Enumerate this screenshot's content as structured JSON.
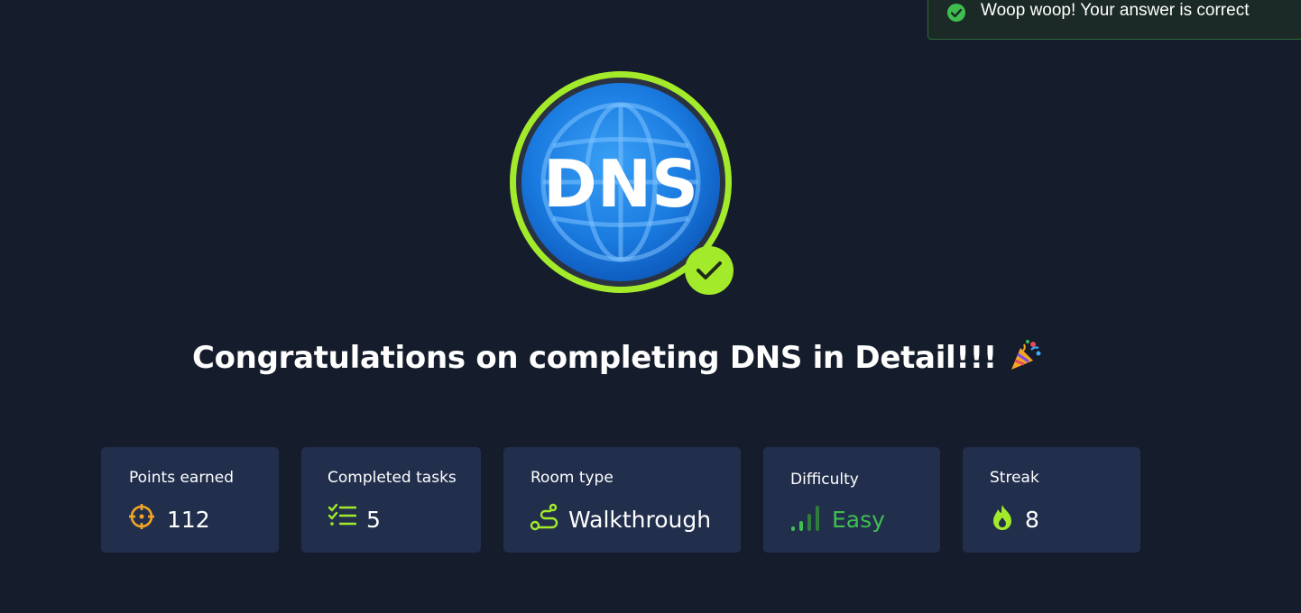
{
  "toast": {
    "message": "Woop woop! Your answer is correct",
    "icon": "check-circle-icon",
    "color": "#3fbe4f"
  },
  "badge": {
    "text": "DNS",
    "icon": "globe-icon",
    "ring_color": "#a3ea2a",
    "completed_icon": "checkmark-icon"
  },
  "heading": {
    "text": "Congratulations on completing DNS in Detail!!!",
    "emoji_icon": "party-popper-icon"
  },
  "stats": {
    "points": {
      "label": "Points earned",
      "value": "112",
      "icon": "crosshair-icon",
      "color": "#f5a524"
    },
    "tasks": {
      "label": "Completed tasks",
      "value": "5",
      "icon": "task-list-icon",
      "color": "#a3ea2a"
    },
    "room_type": {
      "label": "Room type",
      "value": "Walkthrough",
      "icon": "route-icon",
      "color": "#a3ea2a"
    },
    "difficulty": {
      "label": "Difficulty",
      "value": "Easy",
      "icon": "signal-bars-icon",
      "color": "#3fbe4f"
    },
    "streak": {
      "label": "Streak",
      "value": "8",
      "icon": "flame-icon",
      "color": "#a3ea2a"
    }
  }
}
